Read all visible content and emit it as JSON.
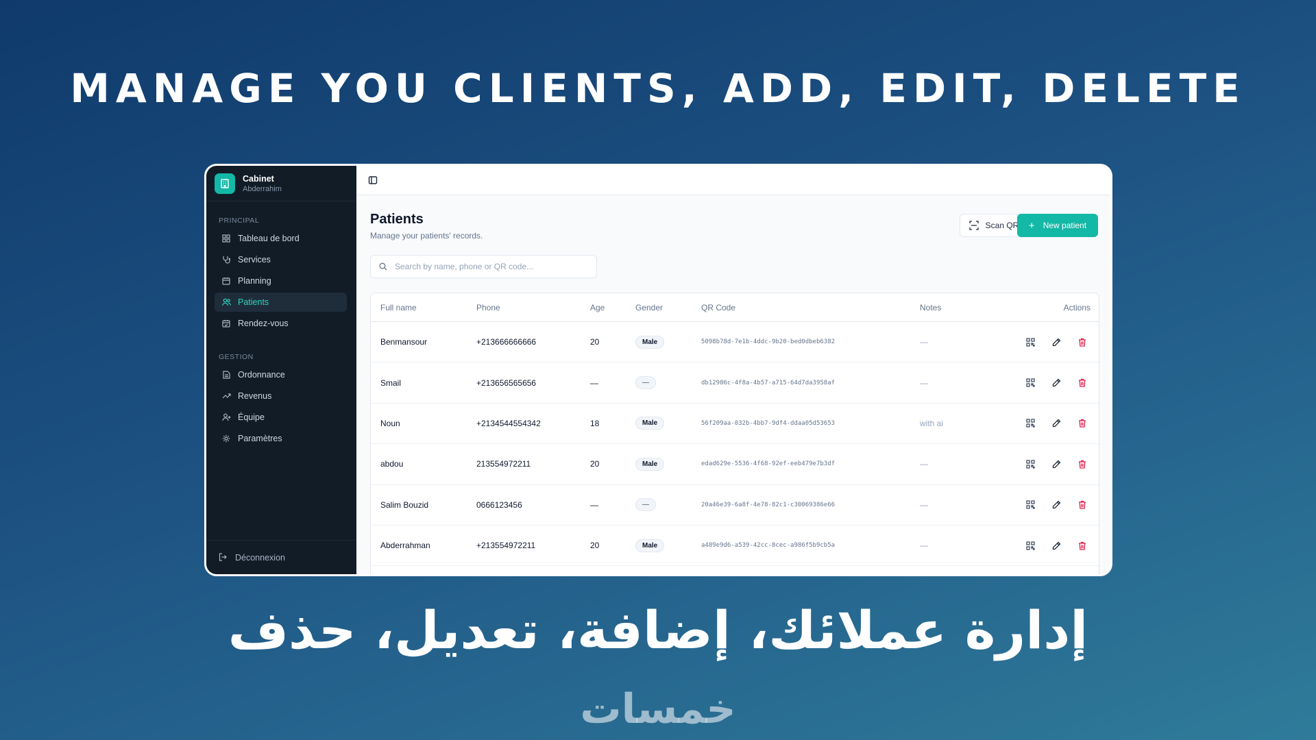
{
  "headline": "MANAGE YOU CLIENTS, ADD, EDIT, DELETE",
  "arabic_title": "إدارة عملائك، إضافة، تعديل، حذف",
  "brand_logo": "خمسات",
  "colors": {
    "accent": "#14b8a6",
    "sidebar_bg": "#111c27",
    "delete": "#e11d48"
  },
  "sidebar": {
    "brand_name": "Cabinet",
    "brand_sub": "Abderrahim",
    "sections": [
      {
        "label": "PRINCIPAL",
        "items": [
          {
            "label": "Tableau de bord",
            "icon": "grid-icon"
          },
          {
            "label": "Services",
            "icon": "stethoscope-icon"
          },
          {
            "label": "Planning",
            "icon": "calendar-icon"
          },
          {
            "label": "Patients",
            "icon": "users-icon",
            "active": true
          },
          {
            "label": "Rendez-vous",
            "icon": "calendar-check-icon"
          }
        ]
      },
      {
        "label": "GESTION",
        "items": [
          {
            "label": "Ordonnance",
            "icon": "document-icon"
          },
          {
            "label": "Revenus",
            "icon": "trending-up-icon"
          },
          {
            "label": "Équipe",
            "icon": "user-plus-icon"
          },
          {
            "label": "Paramètres",
            "icon": "gear-icon"
          }
        ]
      }
    ],
    "logout_label": "Déconnexion"
  },
  "page": {
    "title": "Patients",
    "subtitle": "Manage your patients' records.",
    "scan_label": "Scan QR",
    "new_label": "New patient",
    "search_placeholder": "Search by name, phone or QR code..."
  },
  "table": {
    "headers": [
      "Full name",
      "Phone",
      "Age",
      "Gender",
      "QR Code",
      "Notes",
      "Actions"
    ],
    "rows": [
      {
        "name": "Benmansour",
        "phone": "+213666666666",
        "age": "20",
        "gender": "Male",
        "qr": "5098b78d-7e1b-4ddc-9b20-bed0dbeb6382",
        "notes": "—"
      },
      {
        "name": "Smail",
        "phone": "+213656565656",
        "age": "—",
        "gender": "—",
        "qr": "db12986c-4f8a-4b57-a715-64d7da3958af",
        "notes": "—"
      },
      {
        "name": "Noun",
        "phone": "+2134544554342",
        "age": "18",
        "gender": "Male",
        "qr": "56f209aa-032b-4bb7-9df4-ddaa05d53653",
        "notes": "with ai"
      },
      {
        "name": "abdou",
        "phone": "213554972211",
        "age": "20",
        "gender": "Male",
        "qr": "edad629e-5536-4f68-92ef-eeb479e7b3df",
        "notes": "—"
      },
      {
        "name": "Salim Bouzid",
        "phone": "0666123456",
        "age": "—",
        "gender": "—",
        "qr": "20a46e39-6a8f-4e78-82c1-c30069386e66",
        "notes": "—"
      },
      {
        "name": "Abderrahman",
        "phone": "+213554972211",
        "age": "20",
        "gender": "Male",
        "qr": "a489e9d6-a539-42cc-8cec-a986f5b9cb5a",
        "notes": "—"
      }
    ]
  }
}
